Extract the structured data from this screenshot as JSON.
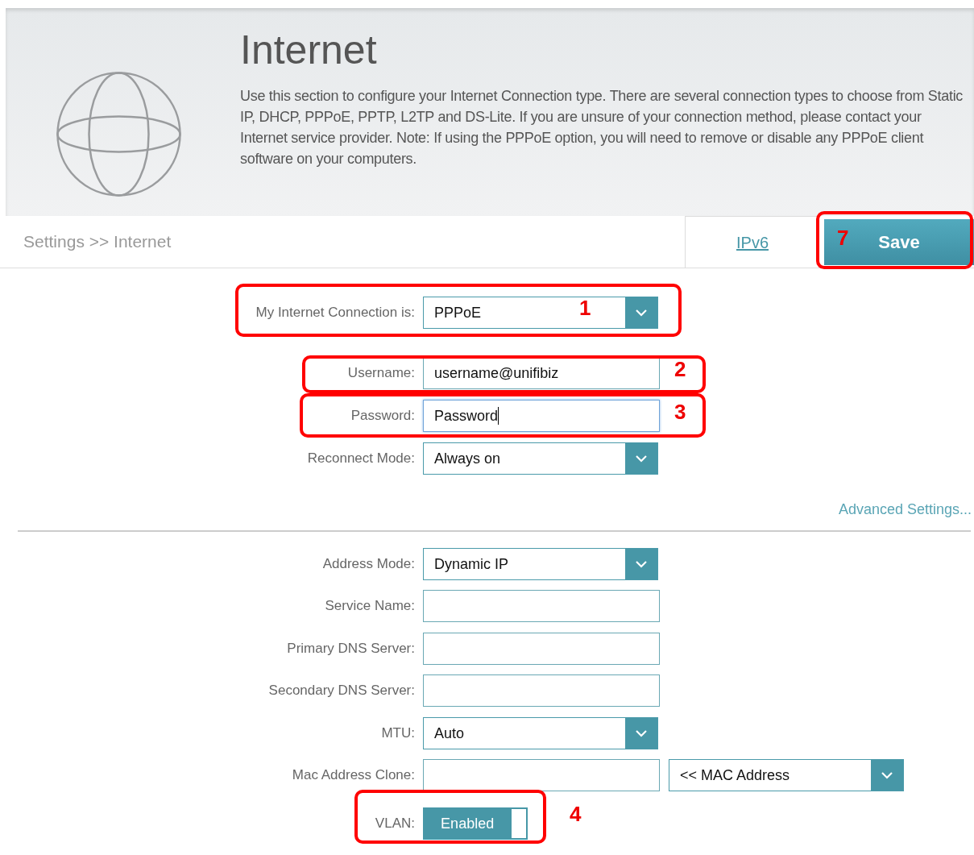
{
  "header": {
    "title": "Internet",
    "description": "Use this section to configure your Internet Connection type. There are several connection types to choose from Static IP, DHCP, PPPoE, PPTP, L2TP and DS-Lite. If you are unsure of your connection method, please contact your Internet service provider. Note: If using the PPPoE option, you will need to remove or disable any PPPoE client software on your computers."
  },
  "breadcrumb": "Settings >> Internet",
  "tabs": [
    {
      "label": "IPv6"
    }
  ],
  "save_button": "Save",
  "fields": [
    {
      "kind": "select",
      "label": "My Internet Connection is:",
      "value": "PPPoE"
    },
    {
      "kind": "text",
      "label": "Username:",
      "value": "username@unifibiz",
      "focused": false
    },
    {
      "kind": "text",
      "label": "Password:",
      "value": "Password",
      "focused": true
    },
    {
      "kind": "select",
      "label": "Reconnect Mode:",
      "value": "Always on"
    }
  ],
  "advanced_link": "Advanced Settings...",
  "advanced_fields": [
    {
      "kind": "select",
      "label": "Address Mode:",
      "value": "Dynamic IP"
    },
    {
      "kind": "text",
      "label": "Service Name:",
      "focused": false
    },
    {
      "kind": "text",
      "label": "Primary DNS Server:",
      "focused": false
    },
    {
      "kind": "text",
      "label": "Secondary DNS Server:",
      "focused": false
    },
    {
      "kind": "select",
      "label": "MTU:",
      "value": "Auto"
    },
    {
      "kind": "text_select",
      "label": "Mac Address Clone:",
      "option": "<< MAC Address"
    },
    {
      "kind": "toggle",
      "label": "VLAN:",
      "value": "Enabled",
      "on": true
    }
  ],
  "annotations": [
    {
      "number": "7"
    },
    {
      "number": "1"
    },
    {
      "number": "2"
    },
    {
      "number": "3"
    },
    {
      "number": "4"
    }
  ]
}
